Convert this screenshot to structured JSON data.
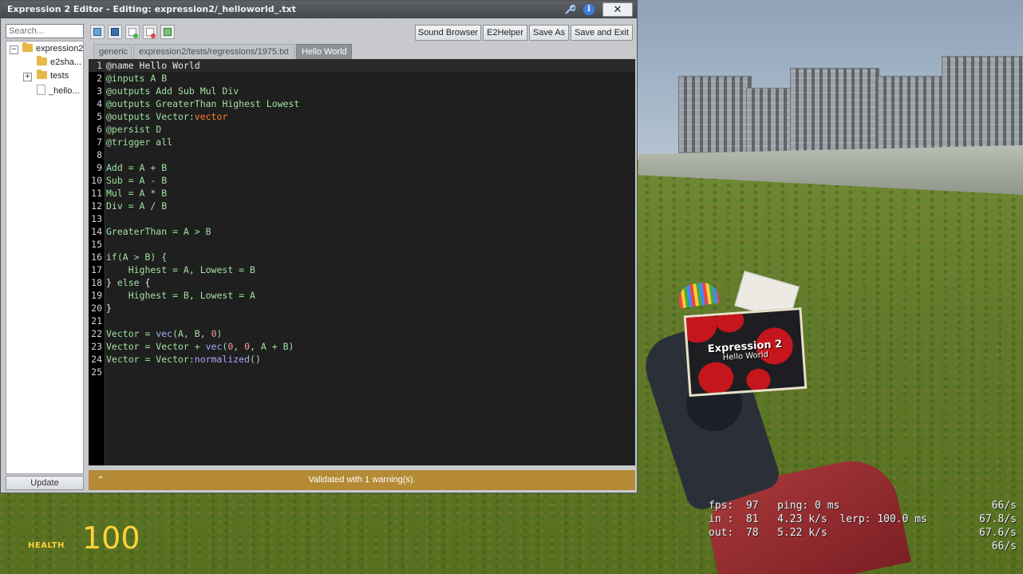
{
  "window": {
    "title": "Expression 2 Editor - Editing: expression2/_helloworld_.txt",
    "close_glyph": "✕",
    "wrench_icon": "wrench-icon",
    "info_icon": "info-icon",
    "info_glyph": "i"
  },
  "sidebar": {
    "search_placeholder": "Search...",
    "tree": [
      {
        "label": "expression2",
        "type": "folder",
        "expander": "−"
      },
      {
        "label": "e2sha...",
        "type": "folder"
      },
      {
        "label": "tests",
        "type": "folder",
        "expander": "+"
      },
      {
        "label": "_hello...",
        "type": "file"
      }
    ],
    "update_label": "Update"
  },
  "toolbar": {
    "icons": [
      "open-folder-icon",
      "save-icon",
      "new-file-icon",
      "close-file-icon",
      "reload-icon"
    ],
    "buttons": [
      "Sound Browser",
      "E2Helper",
      "Save As",
      "Save and Exit"
    ]
  },
  "tabs": [
    {
      "label": "generic",
      "active": false
    },
    {
      "label": "expression2/tests/regressions/1975.txt",
      "active": false
    },
    {
      "label": "Hello World",
      "active": true
    }
  ],
  "code": [
    [
      [
        "@name Hello World",
        "plain"
      ]
    ],
    [
      [
        "@inputs A B",
        "var"
      ]
    ],
    [
      [
        "@outputs Add Sub Mul Div",
        "var"
      ]
    ],
    [
      [
        "@outputs GreaterThan Highest Lowest",
        "var"
      ]
    ],
    [
      [
        "@outputs Vector:",
        "var"
      ],
      [
        "vector",
        "type"
      ]
    ],
    [
      [
        "@persist D",
        "var"
      ]
    ],
    [
      [
        "@trigger all",
        "var"
      ]
    ],
    [],
    [
      [
        "Add = A + B",
        "var"
      ]
    ],
    [
      [
        "Sub = A - B",
        "var"
      ]
    ],
    [
      [
        "Mul = A * B",
        "var"
      ]
    ],
    [
      [
        "Div = A / B",
        "var"
      ]
    ],
    [],
    [
      [
        "GreaterThan = A > B",
        "var"
      ]
    ],
    [],
    [
      [
        "if",
        "kw"
      ],
      [
        "(A > B) {",
        "var"
      ]
    ],
    [
      [
        "    Highest = A, Lowest = B",
        "var"
      ]
    ],
    [
      [
        "} ",
        "plain"
      ],
      [
        "else",
        "kw"
      ],
      [
        " {",
        "plain"
      ]
    ],
    [
      [
        "    Highest = B, Lowest = A",
        "var"
      ]
    ],
    [
      [
        "}",
        "plain"
      ]
    ],
    [],
    [
      [
        "Vector = ",
        "var"
      ],
      [
        "vec",
        "fn"
      ],
      [
        "(A, B, ",
        "var"
      ],
      [
        "0",
        "num"
      ],
      [
        ")",
        "var"
      ]
    ],
    [
      [
        "Vector = Vector + ",
        "var"
      ],
      [
        "vec",
        "fn"
      ],
      [
        "(",
        "var"
      ],
      [
        "0",
        "num"
      ],
      [
        ", ",
        "var"
      ],
      [
        "0",
        "num"
      ],
      [
        ", A + B)",
        "var"
      ]
    ],
    [
      [
        "Vector = Vector:",
        "var"
      ],
      [
        "normalized",
        "fn"
      ],
      [
        "()",
        "var"
      ]
    ],
    []
  ],
  "status": {
    "text": "Validated with 1 warning(s).",
    "chevron": "⌃"
  },
  "hud": {
    "health_label": "HEALTH",
    "health_value": "100",
    "netgraph": [
      {
        "left": "fps:  97   ping: 0 ms",
        "right": "66/s"
      },
      {
        "left": "in :  81   4.23 k/s  lerp: 100.0 ms",
        "right": "67.8/s"
      },
      {
        "left": "out:  78   5.22 k/s",
        "right": "67.6/s"
      },
      {
        "left": "",
        "right": "66/s"
      }
    ]
  },
  "chip_screen": {
    "title": "Expression 2",
    "subtitle": "Hello World"
  }
}
